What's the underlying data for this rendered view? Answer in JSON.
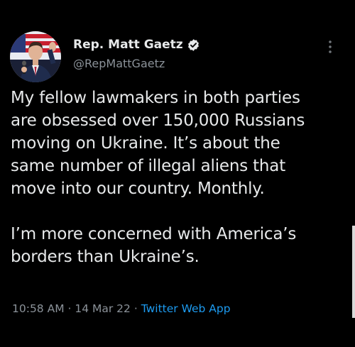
{
  "author": {
    "display_name": "Rep. Matt Gaetz",
    "handle": "@RepMattGaetz",
    "verified": true
  },
  "tweet": {
    "paragraphs": [
      "My fellow lawmakers in both parties\nare obsessed over 150,000 Russians\nmoving on Ukraine. It’s about the\nsame number of illegal aliens that\nmove into our country. Monthly.",
      "I’m more concerned with America’s\nborders than Ukraine’s."
    ]
  },
  "meta": {
    "time": "10:58 AM",
    "separator1": " · ",
    "date": "14 Mar 22",
    "separator2": " · ",
    "source": "Twitter Web App"
  },
  "icons": {
    "verified": "verified-badge-icon",
    "more": "more-options-icon"
  },
  "colors": {
    "background": "#000000",
    "text": "#e7e9ea",
    "secondary": "#8b9299",
    "link": "#1d9bf0"
  }
}
